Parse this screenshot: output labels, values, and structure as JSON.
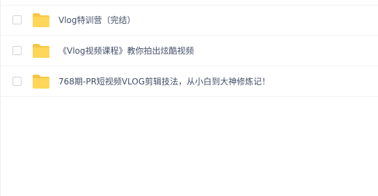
{
  "file_list": {
    "items": [
      {
        "name": "Vlog特训营（完结）",
        "type": "folder",
        "icon": "folder-icon"
      },
      {
        "name": "《Vlog视频课程》教你拍出炫酷视频",
        "type": "folder",
        "icon": "folder-icon"
      },
      {
        "name": "768期-PR短视频VLOG剪辑技法，从小白到大神修炼记！",
        "type": "folder",
        "icon": "folder-icon"
      }
    ]
  },
  "colors": {
    "folder": "#ffd658",
    "folder_tab": "#f8c544",
    "text": "#424e67",
    "divider": "#f2f2f2",
    "checkbox_border": "#d3d3d3"
  }
}
